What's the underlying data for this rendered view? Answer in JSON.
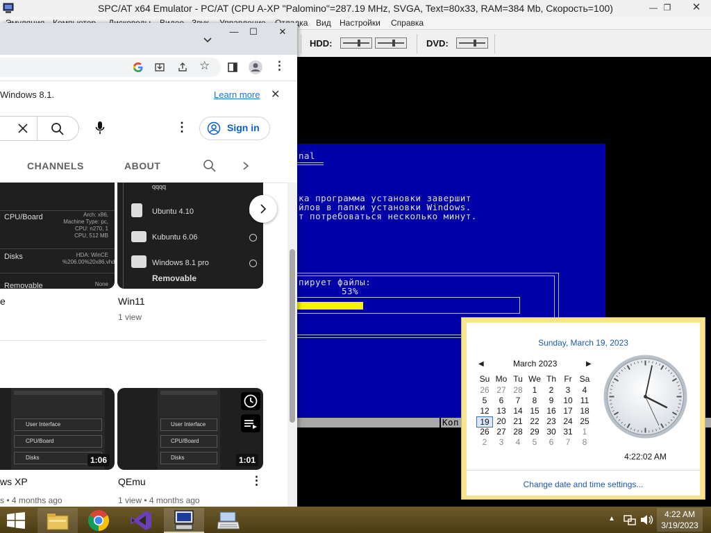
{
  "emulator": {
    "title": "SPC/AT x64 Emulator - PC/AT (CPU A-XP \"Palomino\"=287.19 MHz, SVGA, Text=80x33, RAM=384 Mb, Скорость=100)",
    "menu": [
      "Эмуляция",
      "Компьютер",
      "Дисководы",
      "Видео",
      "Звук",
      "Управление",
      "Отладка",
      "Вид",
      "Настройки",
      "Справка"
    ],
    "toolbar": {
      "hdd_label": "HDD:",
      "dvd_label": "DVD:"
    }
  },
  "dos": {
    "heading": "nal",
    "lines": [
      "ка программа установки завершит",
      "йлов в папки установки Windows.",
      "т потребоваться несколько минут."
    ],
    "copy_label": "пирует файлы:",
    "percent": "53%",
    "progress_fraction": 0.53,
    "status_text": "Коп"
  },
  "browser": {
    "info_text": "Windows 8.1.",
    "learn_more": "Learn more",
    "sign_in": "Sign in",
    "tabs": [
      "CHANNELS",
      "ABOUT"
    ],
    "videos_top": [
      {
        "title": "e",
        "thumb_rows": [
          {
            "label": "CPU/Board",
            "detail": "Arch: x86, Machine Type: pc, CPU: n270, 1 CPU, 512 MB"
          },
          {
            "label": "Disks",
            "detail": "HDA: WinCE %206.00%20x86.vhd"
          },
          {
            "label": "Removable",
            "detail": "None"
          }
        ]
      },
      {
        "title": "Win11",
        "meta": "1 view",
        "thumb_rows": [
          {
            "label": "qqqq"
          },
          {
            "label": "Ubuntu 4.10"
          },
          {
            "label": "Kubuntu 6.06"
          },
          {
            "label": "Windows 8.1 pro"
          },
          {
            "label": "Removable"
          }
        ]
      }
    ],
    "videos_bottom": [
      {
        "title": "ws XP",
        "meta": "s • 4 months ago",
        "duration": "1:06"
      },
      {
        "title": "QEmu",
        "meta": "1 view • 4 months ago",
        "duration": "1:01"
      }
    ],
    "thumb_small_labels": [
      "User Interface",
      "CPU/Board",
      "Disks"
    ]
  },
  "calendar": {
    "date_long": "Sunday, March 19, 2023",
    "month": "March 2023",
    "weekdays": [
      "Su",
      "Mo",
      "Tu",
      "We",
      "Th",
      "Fr",
      "Sa"
    ],
    "weeks": [
      [
        "26",
        "27",
        "28",
        "1",
        "2",
        "3",
        "4"
      ],
      [
        "5",
        "6",
        "7",
        "8",
        "9",
        "10",
        "11"
      ],
      [
        "12",
        "13",
        "14",
        "15",
        "16",
        "17",
        "18"
      ],
      [
        "19",
        "20",
        "21",
        "22",
        "23",
        "24",
        "25"
      ],
      [
        "26",
        "27",
        "28",
        "29",
        "30",
        "31",
        "1"
      ],
      [
        "2",
        "3",
        "4",
        "5",
        "6",
        "7",
        "8"
      ]
    ],
    "time": "4:22:02 AM",
    "link": "Change date and time settings..."
  },
  "taskbar": {
    "time": "4:22 AM",
    "date": "3/19/2023"
  }
}
